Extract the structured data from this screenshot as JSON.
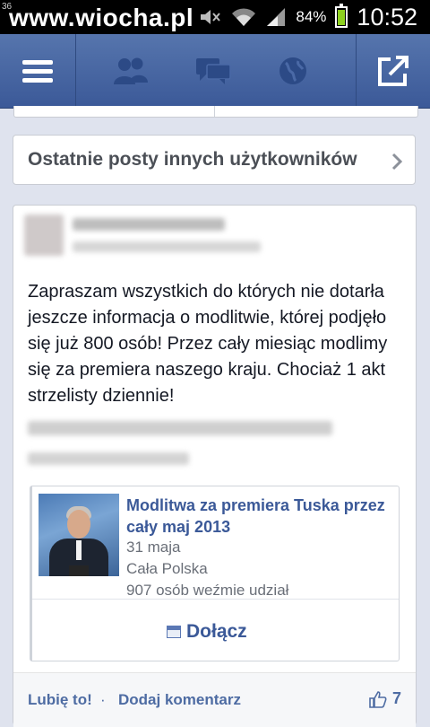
{
  "status_bar": {
    "watermark": "www.wiocha.pl",
    "corner_badge": "36",
    "battery": "84%",
    "battery_level": 0.84,
    "time": "10:52"
  },
  "nav": {
    "icons": [
      "menu-icon",
      "friends-icon",
      "messages-icon",
      "globe-icon",
      "compose-icon"
    ]
  },
  "recent_posts": {
    "label": "Ostatnie posty innych użytkowników"
  },
  "post": {
    "message": "Zapraszam wszystkich do których nie dotarła jeszcze informacja o modlitwie, której podjęło się już 800 osób! Przez cały miesiąc modlimy się za premiera naszego kraju. Chociaż 1 akt strzelisty dziennie!",
    "event": {
      "title": "Modlitwa za premiera Tuska przez cały maj 2013",
      "date": "31 maja",
      "location": "Cała Polska",
      "attendees": "907 osób weźmie udział",
      "join_label": "Dołącz"
    },
    "actions": {
      "like": "Lubię to!",
      "separator": "·",
      "comment": "Dodaj komentarz",
      "like_count": "7"
    }
  },
  "colors": {
    "nav_bg": "#3b5998",
    "link": "#3b5998",
    "page_bg": "#dfe3ee"
  }
}
